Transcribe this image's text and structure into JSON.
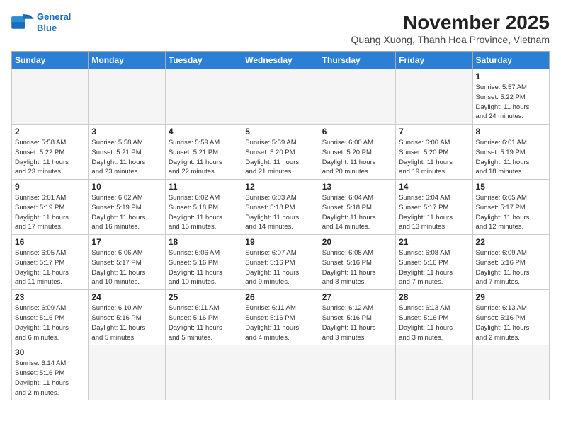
{
  "header": {
    "logo_line1": "General",
    "logo_line2": "Blue",
    "month": "November 2025",
    "location": "Quang Xuong, Thanh Hoa Province, Vietnam"
  },
  "weekdays": [
    "Sunday",
    "Monday",
    "Tuesday",
    "Wednesday",
    "Thursday",
    "Friday",
    "Saturday"
  ],
  "days": [
    {
      "num": "",
      "info": ""
    },
    {
      "num": "",
      "info": ""
    },
    {
      "num": "",
      "info": ""
    },
    {
      "num": "",
      "info": ""
    },
    {
      "num": "",
      "info": ""
    },
    {
      "num": "",
      "info": ""
    },
    {
      "num": "1",
      "info": "Sunrise: 5:57 AM\nSunset: 5:22 PM\nDaylight: 11 hours\nand 24 minutes."
    },
    {
      "num": "2",
      "info": "Sunrise: 5:58 AM\nSunset: 5:22 PM\nDaylight: 11 hours\nand 23 minutes."
    },
    {
      "num": "3",
      "info": "Sunrise: 5:58 AM\nSunset: 5:21 PM\nDaylight: 11 hours\nand 23 minutes."
    },
    {
      "num": "4",
      "info": "Sunrise: 5:59 AM\nSunset: 5:21 PM\nDaylight: 11 hours\nand 22 minutes."
    },
    {
      "num": "5",
      "info": "Sunrise: 5:59 AM\nSunset: 5:20 PM\nDaylight: 11 hours\nand 21 minutes."
    },
    {
      "num": "6",
      "info": "Sunrise: 6:00 AM\nSunset: 5:20 PM\nDaylight: 11 hours\nand 20 minutes."
    },
    {
      "num": "7",
      "info": "Sunrise: 6:00 AM\nSunset: 5:20 PM\nDaylight: 11 hours\nand 19 minutes."
    },
    {
      "num": "8",
      "info": "Sunrise: 6:01 AM\nSunset: 5:19 PM\nDaylight: 11 hours\nand 18 minutes."
    },
    {
      "num": "9",
      "info": "Sunrise: 6:01 AM\nSunset: 5:19 PM\nDaylight: 11 hours\nand 17 minutes."
    },
    {
      "num": "10",
      "info": "Sunrise: 6:02 AM\nSunset: 5:19 PM\nDaylight: 11 hours\nand 16 minutes."
    },
    {
      "num": "11",
      "info": "Sunrise: 6:02 AM\nSunset: 5:18 PM\nDaylight: 11 hours\nand 15 minutes."
    },
    {
      "num": "12",
      "info": "Sunrise: 6:03 AM\nSunset: 5:18 PM\nDaylight: 11 hours\nand 14 minutes."
    },
    {
      "num": "13",
      "info": "Sunrise: 6:04 AM\nSunset: 5:18 PM\nDaylight: 11 hours\nand 14 minutes."
    },
    {
      "num": "14",
      "info": "Sunrise: 6:04 AM\nSunset: 5:17 PM\nDaylight: 11 hours\nand 13 minutes."
    },
    {
      "num": "15",
      "info": "Sunrise: 6:05 AM\nSunset: 5:17 PM\nDaylight: 11 hours\nand 12 minutes."
    },
    {
      "num": "16",
      "info": "Sunrise: 6:05 AM\nSunset: 5:17 PM\nDaylight: 11 hours\nand 11 minutes."
    },
    {
      "num": "17",
      "info": "Sunrise: 6:06 AM\nSunset: 5:17 PM\nDaylight: 11 hours\nand 10 minutes."
    },
    {
      "num": "18",
      "info": "Sunrise: 6:06 AM\nSunset: 5:16 PM\nDaylight: 11 hours\nand 10 minutes."
    },
    {
      "num": "19",
      "info": "Sunrise: 6:07 AM\nSunset: 5:16 PM\nDaylight: 11 hours\nand 9 minutes."
    },
    {
      "num": "20",
      "info": "Sunrise: 6:08 AM\nSunset: 5:16 PM\nDaylight: 11 hours\nand 8 minutes."
    },
    {
      "num": "21",
      "info": "Sunrise: 6:08 AM\nSunset: 5:16 PM\nDaylight: 11 hours\nand 7 minutes."
    },
    {
      "num": "22",
      "info": "Sunrise: 6:09 AM\nSunset: 5:16 PM\nDaylight: 11 hours\nand 7 minutes."
    },
    {
      "num": "23",
      "info": "Sunrise: 6:09 AM\nSunset: 5:16 PM\nDaylight: 11 hours\nand 6 minutes."
    },
    {
      "num": "24",
      "info": "Sunrise: 6:10 AM\nSunset: 5:16 PM\nDaylight: 11 hours\nand 5 minutes."
    },
    {
      "num": "25",
      "info": "Sunrise: 6:11 AM\nSunset: 5:16 PM\nDaylight: 11 hours\nand 5 minutes."
    },
    {
      "num": "26",
      "info": "Sunrise: 6:11 AM\nSunset: 5:16 PM\nDaylight: 11 hours\nand 4 minutes."
    },
    {
      "num": "27",
      "info": "Sunrise: 6:12 AM\nSunset: 5:16 PM\nDaylight: 11 hours\nand 3 minutes."
    },
    {
      "num": "28",
      "info": "Sunrise: 6:13 AM\nSunset: 5:16 PM\nDaylight: 11 hours\nand 3 minutes."
    },
    {
      "num": "29",
      "info": "Sunrise: 6:13 AM\nSunset: 5:16 PM\nDaylight: 11 hours\nand 2 minutes."
    },
    {
      "num": "30",
      "info": "Sunrise: 6:14 AM\nSunset: 5:16 PM\nDaylight: 11 hours\nand 2 minutes."
    },
    {
      "num": "",
      "info": ""
    },
    {
      "num": "",
      "info": ""
    },
    {
      "num": "",
      "info": ""
    },
    {
      "num": "",
      "info": ""
    },
    {
      "num": "",
      "info": ""
    },
    {
      "num": "",
      "info": ""
    }
  ]
}
